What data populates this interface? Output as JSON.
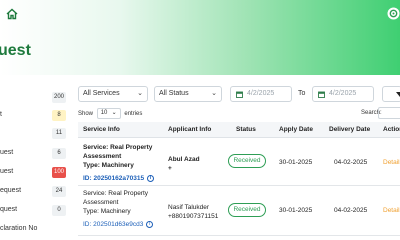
{
  "header": {
    "title": "uest",
    "accent_color": "#3fcf72",
    "home_icon": "home-icon",
    "right_icon": "refresh-gear-icon"
  },
  "sidebar": {
    "items": [
      {
        "label": "",
        "count": "200",
        "highlight": false
      },
      {
        "label": "t",
        "count": "8",
        "highlight": true
      },
      {
        "label": "",
        "count": "11",
        "highlight": false
      },
      {
        "label": "uest",
        "count": "6",
        "highlight": false
      },
      {
        "label": "uest",
        "count": "100",
        "highlight": false,
        "red": true
      },
      {
        "label": "equest",
        "count": "24",
        "highlight": false
      },
      {
        "label": "quest",
        "count": "0",
        "highlight": false
      },
      {
        "label": "claration No",
        "count": "",
        "highlight": false
      }
    ]
  },
  "filters": {
    "services": "All Services",
    "status": "All Status",
    "date_from": "4/2/2025",
    "to_label": "To",
    "date_to": "4/2/2025"
  },
  "table_controls": {
    "show_label": "Show",
    "entries_value": "10",
    "entries_label": "entries",
    "search_label": "Search:"
  },
  "table": {
    "headers": [
      "Service Info",
      "Applicant Info",
      "Status",
      "Apply Date",
      "Delivery Date",
      "Action"
    ],
    "rows": [
      {
        "service_line1": "Service: Real Property",
        "service_line2": "Assessment",
        "service_line3": "Type: Machinery",
        "id": "ID: 20250162a70315",
        "applicant_name": "Abul Azad",
        "applicant_phone": "+",
        "status": "Received",
        "apply_date": "30-01-2025",
        "delivery_date": "04-02-2025",
        "action": "Details",
        "bold": true
      },
      {
        "service_line1": "Service: Real Property",
        "service_line2": "Assessment",
        "service_line3": "Type: Machinery",
        "id": "ID: 202501d63e9cd3",
        "applicant_name": "Nasif Talukder",
        "applicant_phone": "+8801907371151",
        "status": "Received",
        "apply_date": "30-01-2025",
        "delivery_date": "04-02-2025",
        "action": "Details",
        "bold": false
      },
      {
        "service_line1": "",
        "service_line2": "",
        "service_line3": "",
        "id": "",
        "applicant_name": "",
        "applicant_phone": "",
        "status": "",
        "apply_date": "",
        "delivery_date": "",
        "action": "",
        "bold": false
      }
    ]
  }
}
